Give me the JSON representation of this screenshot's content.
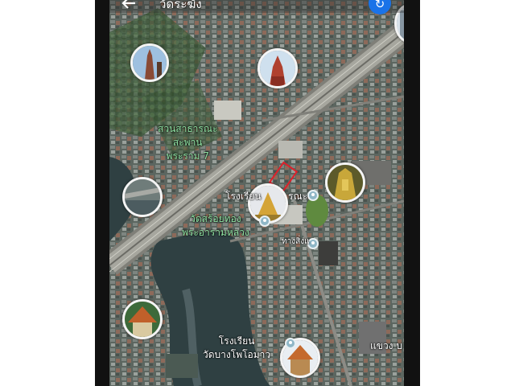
{
  "header": {
    "back_icon": "arrow-left-icon",
    "title": "วัดระฆัง",
    "refresh_icon": "refresh-icon",
    "accent": "#1a73e8"
  },
  "labels": {
    "park_line1": "สวนสาธารณะ",
    "park_line2": "สะพาน",
    "park_line3": "พระราม 7",
    "temple_line1": "วัดสร้อยทอง",
    "temple_line2": "พระอารามหลวง",
    "school_top": "โรงเรียน",
    "public_fragment": "รณะ",
    "hospital_fragment": "ทางสิ่งแ",
    "school_bottom_line1": "โรงเรียน",
    "school_bottom_line2": "วัดบางโพโอมาว",
    "district_fragment": "แขวง บ"
  },
  "place_photos": [
    "pagoda-photo-icon",
    "red-prang-photo-icon",
    "golden-shrine-photo-icon",
    "riverside-photo-icon",
    "golden-stupa-photo-icon",
    "temple-roof-photo-icon",
    "chapel-photo-icon",
    "tower-photo-icon"
  ],
  "colors": {
    "green_label": "#8fe0a2",
    "marker": "#e0202a",
    "river": "#2f4042"
  }
}
